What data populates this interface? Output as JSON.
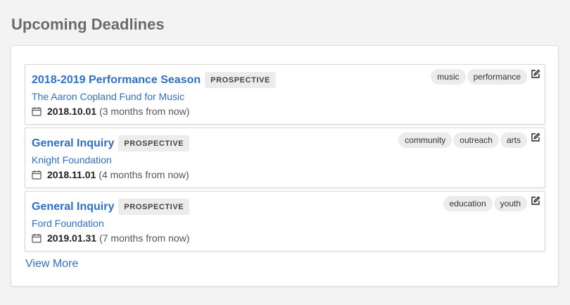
{
  "page": {
    "title": "Upcoming Deadlines"
  },
  "deadlines": [
    {
      "title": "2018-2019 Performance Season",
      "status": "PROSPECTIVE",
      "organization": "The Aaron Copland Fund for Music",
      "date": "2018.10.01",
      "relative": "(3 months from now)",
      "tags": [
        "music",
        "performance"
      ]
    },
    {
      "title": "General Inquiry",
      "status": "PROSPECTIVE",
      "organization": "Knight Foundation",
      "date": "2018.11.01",
      "relative": "(4 months from now)",
      "tags": [
        "community",
        "outreach",
        "arts"
      ]
    },
    {
      "title": "General Inquiry",
      "status": "PROSPECTIVE",
      "organization": "Ford Foundation",
      "date": "2019.01.31",
      "relative": "(7 months from now)",
      "tags": [
        "education",
        "youth"
      ]
    }
  ],
  "footer": {
    "view_more": "View More"
  },
  "icons": {
    "date": "calendar-icon",
    "edit": "edit-icon"
  },
  "colors": {
    "link": "#2f6fc7",
    "badge_bg": "#ececec",
    "title": "#6b6b6b"
  }
}
